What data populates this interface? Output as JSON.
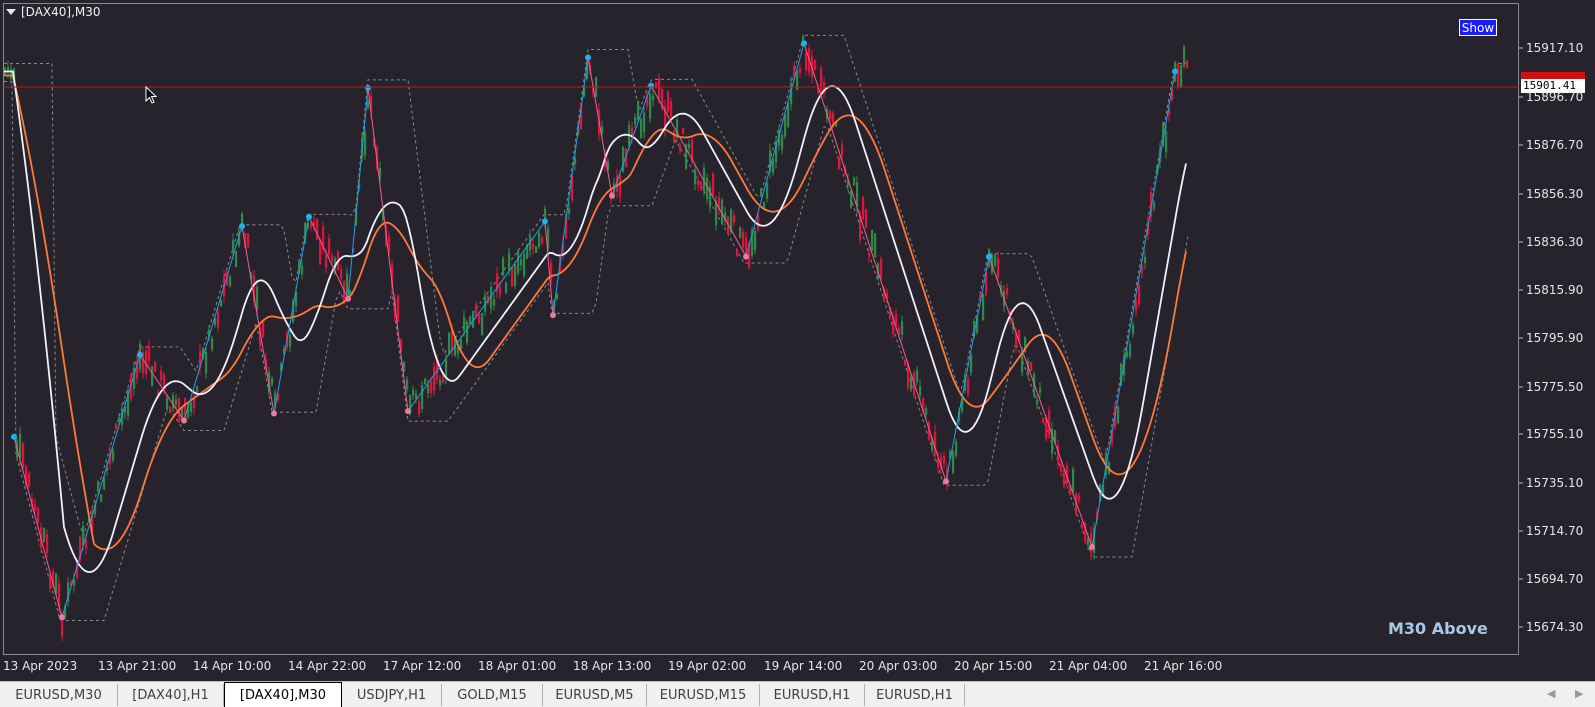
{
  "window": {
    "title": "[DAX40],M30"
  },
  "show_button": "Show",
  "watermark": "M30 Above",
  "current_price": "15901.41",
  "price_axis": [
    "15917.10",
    "15896.70",
    "15876.70",
    "15856.30",
    "15836.30",
    "15815.90",
    "15795.90",
    "15775.50",
    "15755.10",
    "15735.10",
    "15714.70",
    "15694.70",
    "15674.30"
  ],
  "time_axis": [
    "13 Apr 2023",
    "13 Apr 21:00",
    "14 Apr 10:00",
    "14 Apr 22:00",
    "17 Apr 12:00",
    "18 Apr 01:00",
    "18 Apr 13:00",
    "19 Apr 02:00",
    "19 Apr 14:00",
    "20 Apr 03:00",
    "20 Apr 15:00",
    "21 Apr 04:00",
    "21 Apr 16:00"
  ],
  "tabs": [
    {
      "label": "EURUSD,M30",
      "active": false
    },
    {
      "label": "[DAX40],H1",
      "active": false
    },
    {
      "label": "[DAX40],M30",
      "active": true
    },
    {
      "label": "USDJPY,H1",
      "active": false
    },
    {
      "label": "GOLD,M15",
      "active": false
    },
    {
      "label": "EURUSD,M5",
      "active": false
    },
    {
      "label": "EURUSD,M15",
      "active": false
    },
    {
      "label": "EURUSD,H1",
      "active": false
    },
    {
      "label": "EURUSD,H1",
      "active": false
    }
  ],
  "tab_nav": {
    "prev": "◀",
    "next": "▶"
  },
  "colors": {
    "background": "#26232c",
    "bull": "#2e8b4a",
    "bear": "#e0143c",
    "zigzag_up": "#20a0e8",
    "zigzag_down": "#f06090",
    "ma_fast": "#f0f0ff",
    "ma_slow": "#ff7a3a",
    "price_line": "#c01818"
  },
  "chart_data": {
    "type": "candlestick",
    "symbol": "[DAX40]",
    "timeframe": "M30",
    "ylim": [
      15664,
      15930
    ],
    "pivots": [
      {
        "time": "13 Apr 2023",
        "price": 15752,
        "kind": "high"
      },
      {
        "time": "13 Apr",
        "price": 15675,
        "kind": "low"
      },
      {
        "time": "13 Apr 21:00",
        "price": 15787,
        "kind": "high"
      },
      {
        "time": "14 Apr",
        "price": 15759,
        "kind": "low"
      },
      {
        "time": "14 Apr 10:00",
        "price": 15842,
        "kind": "high"
      },
      {
        "time": "14 Apr",
        "price": 15762,
        "kind": "low"
      },
      {
        "time": "14 Apr 22:00",
        "price": 15846,
        "kind": "high"
      },
      {
        "time": "14 Apr",
        "price": 15811,
        "kind": "low"
      },
      {
        "time": "17 Apr",
        "price": 15901,
        "kind": "high"
      },
      {
        "time": "17 Apr 12:00",
        "price": 15763,
        "kind": "low"
      },
      {
        "time": "18 Apr 01:00",
        "price": 15844,
        "kind": "high"
      },
      {
        "time": "18 Apr",
        "price": 15804,
        "kind": "low"
      },
      {
        "time": "18 Apr 13:00",
        "price": 15914,
        "kind": "high"
      },
      {
        "time": "18 Apr",
        "price": 15855,
        "kind": "low"
      },
      {
        "time": "19 Apr",
        "price": 15902,
        "kind": "high"
      },
      {
        "time": "19 Apr",
        "price": 15829,
        "kind": "low"
      },
      {
        "time": "19 Apr 14:00",
        "price": 15920,
        "kind": "high"
      },
      {
        "time": "20 Apr 15:00",
        "price": 15733,
        "kind": "low"
      },
      {
        "time": "20 Apr 15:00",
        "price": 15829,
        "kind": "high"
      },
      {
        "time": "21 Apr 04:00",
        "price": 15705,
        "kind": "low"
      },
      {
        "time": "21 Apr 16:00",
        "price": 15908,
        "kind": "high"
      }
    ]
  }
}
